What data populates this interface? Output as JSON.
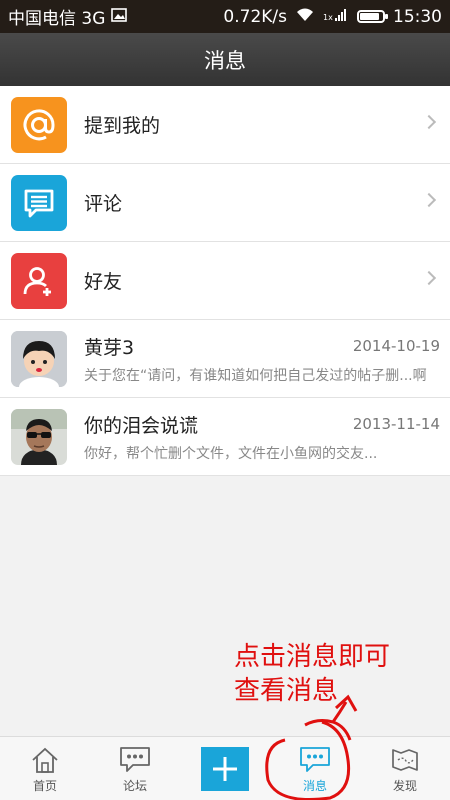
{
  "status_bar": {
    "carrier": "中国电信 3G",
    "speed": "0.72K/s",
    "time": "15:30",
    "battery_level": 0.85
  },
  "header": {
    "title": "消息"
  },
  "menu": [
    {
      "label": "提到我的",
      "icon": "at-icon",
      "color": "#f7931e"
    },
    {
      "label": "评论",
      "icon": "comment-icon",
      "color": "#1aa5d9"
    },
    {
      "label": "好友",
      "icon": "add-friend-icon",
      "color": "#e8403f"
    }
  ],
  "conversations": [
    {
      "name": "黄芽3",
      "date": "2014-10-19",
      "preview": "关于您在“请问，有谁知道如何把自己发过的帖子删...啊"
    },
    {
      "name": "你的泪会说谎",
      "date": "2013-11-14",
      "preview": "你好，帮个忙删个文件，文件在小鱼网的交友..."
    }
  ],
  "annotation": {
    "line1": "点击消息即可",
    "line2": "查看消息"
  },
  "tabs": [
    {
      "label": "首页",
      "icon": "home-icon"
    },
    {
      "label": "论坛",
      "icon": "forum-icon"
    },
    {
      "label": "",
      "icon": "plus-icon"
    },
    {
      "label": "消息",
      "icon": "message-icon",
      "active": true
    },
    {
      "label": "发现",
      "icon": "discover-icon"
    }
  ],
  "colors": {
    "accent": "#1aa5d9",
    "annotation": "#e0100f"
  }
}
